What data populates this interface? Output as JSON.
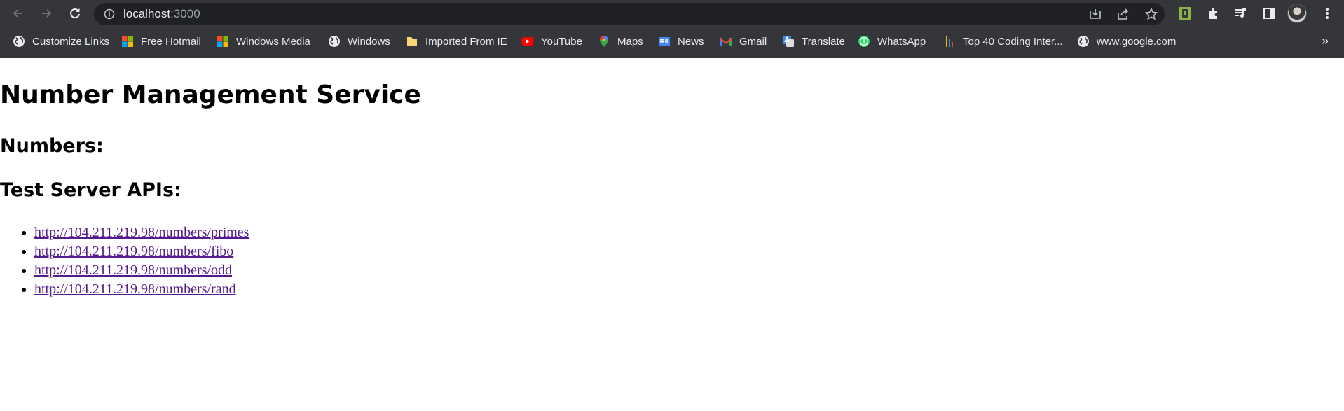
{
  "browser": {
    "url_host": "localhost",
    "url_port": ":3000"
  },
  "bookmarks": [
    {
      "label": "Customize Links",
      "icon": "globe-icon"
    },
    {
      "label": "Free Hotmail",
      "icon": "windows-logo-icon"
    },
    {
      "label": "Windows Media",
      "icon": "windows-logo-icon"
    },
    {
      "label": "Windows",
      "icon": "globe-icon"
    },
    {
      "label": "Imported From IE",
      "icon": "folder-icon"
    },
    {
      "label": "YouTube",
      "icon": "youtube-icon"
    },
    {
      "label": "Maps",
      "icon": "maps-icon"
    },
    {
      "label": "News",
      "icon": "news-icon"
    },
    {
      "label": "Gmail",
      "icon": "gmail-icon"
    },
    {
      "label": "Translate",
      "icon": "translate-icon"
    },
    {
      "label": "WhatsApp",
      "icon": "whatsapp-icon"
    },
    {
      "label": "Top 40 Coding Inter...",
      "icon": "bars-icon"
    },
    {
      "label": "www.google.com",
      "icon": "globe-icon"
    }
  ],
  "bookmarks_overflow": "»",
  "page": {
    "title": "Number Management Service",
    "numbers_heading": "Numbers:",
    "apis_heading": "Test Server APIs:",
    "api_links": [
      "http://104.211.219.98/numbers/primes",
      "http://104.211.219.98/numbers/fibo",
      "http://104.211.219.98/numbers/odd",
      "http://104.211.219.98/numbers/rand"
    ]
  },
  "colors": {
    "chrome_bg": "#35363a",
    "omnibox_bg": "#202124",
    "visited_link": "#551a8b"
  }
}
